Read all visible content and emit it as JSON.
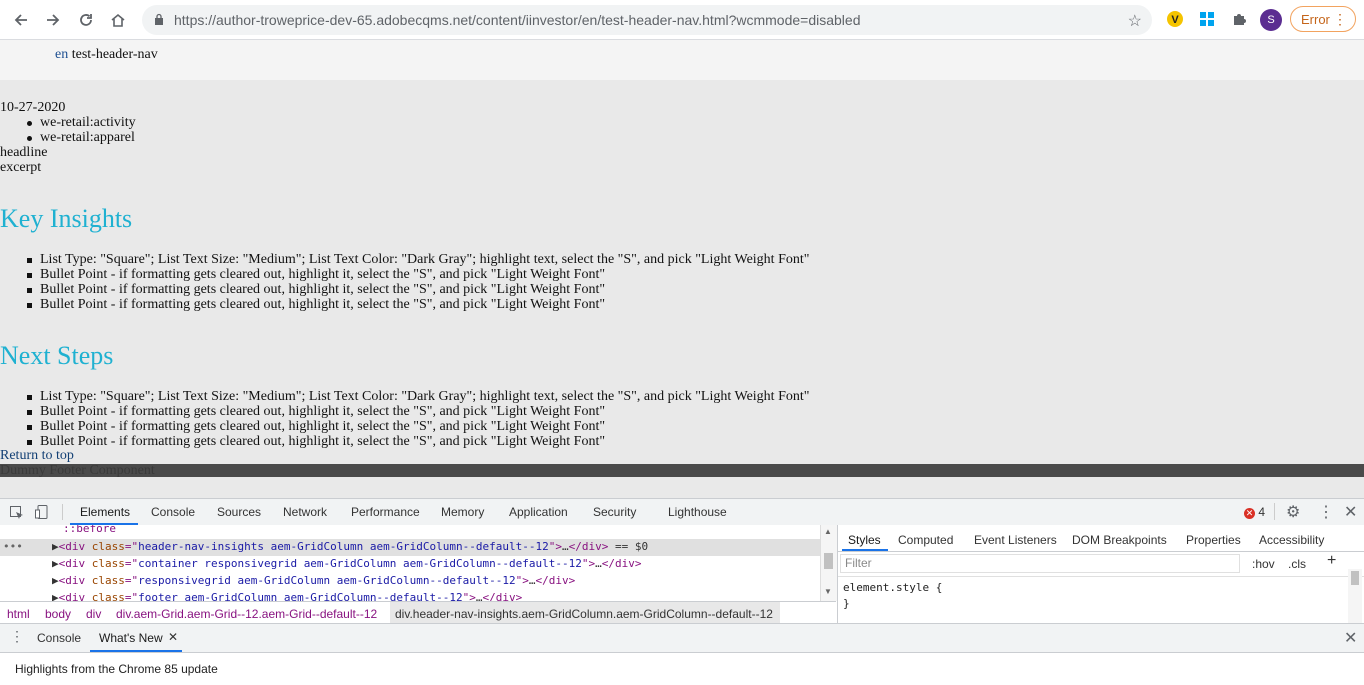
{
  "browser": {
    "url_main": "https://author-troweprice-dev-65.adobecqms.net",
    "url_path": "/content/iinvestor/en/test-header-nav.html?wcmmode=disabled",
    "avatar_letter": "S",
    "error_label": "Error",
    "icons": [
      "back-arrow-icon",
      "forward-arrow-icon",
      "reload-icon",
      "home-icon",
      "lock-icon",
      "star-icon",
      "v-extension-icon",
      "windows-extension-icon",
      "puzzle-extension-icon",
      "kebab-menu-icon"
    ]
  },
  "page": {
    "lang": "en",
    "crumb_title": "test-header-nav",
    "date": "10-27-2020",
    "tags": [
      "we-retail:activity",
      "we-retail:apparel"
    ],
    "headline": "headline",
    "excerpt": "excerpt",
    "section1_title": "Key Insights",
    "section1_items": [
      "List Type: \"Square\"; List Text Size: \"Medium\"; List Text Color: \"Dark Gray\"; highlight text, select the \"S\", and pick \"Light Weight Font\"",
      "Bullet Point - if formatting gets cleared out, highlight it, select the \"S\", and pick \"Light Weight Font\"",
      "Bullet Point - if formatting gets cleared out, highlight it, select the \"S\", and pick \"Light Weight Font\"",
      "Bullet Point - if formatting gets cleared out, highlight it, select the \"S\", and pick \"Light Weight Font\""
    ],
    "section2_title": "Next Steps",
    "section2_items": [
      "List Type: \"Square\"; List Text Size: \"Medium\"; List Text Color: \"Dark Gray\"; highlight text, select the \"S\", and pick \"Light Weight Font\"",
      "Bullet Point - if formatting gets cleared out, highlight it, select the \"S\", and pick \"Light Weight Font\"",
      "Bullet Point - if formatting gets cleared out, highlight it, select the \"S\", and pick \"Light Weight Font\"",
      "Bullet Point - if formatting gets cleared out, highlight it, select the \"S\", and pick \"Light Weight Font\""
    ],
    "return_top": "Return to top",
    "footer_text": "Dummy Footer Component"
  },
  "devtools": {
    "tabs": [
      "Elements",
      "Console",
      "Sources",
      "Network",
      "Performance",
      "Memory",
      "Application",
      "Security",
      "Lighthouse"
    ],
    "error_count": "4",
    "dom_lines": {
      "before": "::before",
      "l1_class": "header-nav-insights aem-GridColumn aem-GridColumn--default--12",
      "l1_suffix": "== $0",
      "l2_class": "container responsivegrid aem-GridColumn aem-GridColumn--default--12",
      "l3_class": "responsivegrid aem-GridColumn aem-GridColumn--default--12",
      "l4_class": "footer aem-GridColumn aem-GridColumn--default--12"
    },
    "breadcrumbs": [
      "html",
      "body",
      "div",
      "div.aem-Grid.aem-Grid--12.aem-Grid--default--12",
      "div.header-nav-insights.aem-GridColumn.aem-GridColumn--default--12"
    ],
    "styles_tabs": [
      "Styles",
      "Computed",
      "Event Listeners",
      "DOM Breakpoints",
      "Properties",
      "Accessibility"
    ],
    "filter_placeholder": "Filter",
    "hov": ":hov",
    "cls": ".cls",
    "element_style_open": "element.style {",
    "element_style_close": "}",
    "drawer_tabs": [
      "Console",
      "What's New"
    ],
    "drawer_body": "Highlights from the Chrome 85 update"
  }
}
